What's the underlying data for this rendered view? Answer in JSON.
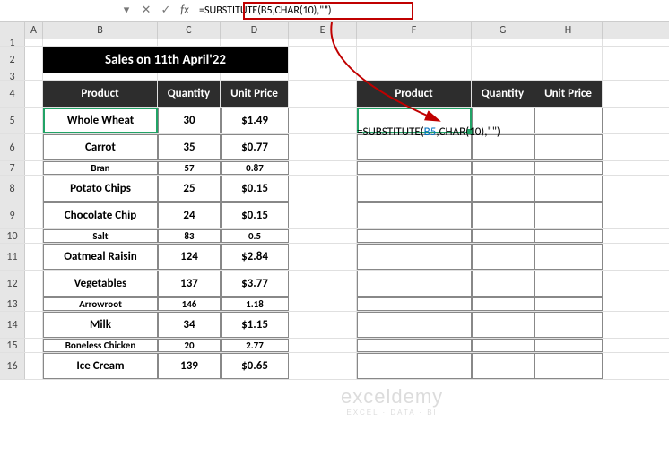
{
  "formula_bar": {
    "formula": "=SUBSTITUTE(B5,CHAR(10),\"\")",
    "fx_label": "fx"
  },
  "columns": [
    "A",
    "B",
    "C",
    "D",
    "E",
    "F",
    "G",
    "H"
  ],
  "row_numbers": [
    "1",
    "2",
    "3",
    "4",
    "5",
    "6",
    "7",
    "8",
    "9",
    "10",
    "11",
    "12",
    "13",
    "14",
    "15",
    "16"
  ],
  "title": "Sales on 11th April'22",
  "headers": {
    "product": "Product",
    "quantity": "Quantity",
    "unit_price": "Unit Price"
  },
  "data_rows": [
    {
      "product": "Whole Wheat",
      "qty": "30",
      "price": "$1.49",
      "thin": false
    },
    {
      "product": "Carrot",
      "qty": "35",
      "price": "$0.77",
      "thin": false
    },
    {
      "product": "Bran",
      "qty": "57",
      "price": "0.87",
      "thin": true
    },
    {
      "product": "Potato Chips",
      "qty": "25",
      "price": "$0.15",
      "thin": false
    },
    {
      "product": "Chocolate Chip",
      "qty": "24",
      "price": "$0.15",
      "thin": false
    },
    {
      "product": "Salt",
      "qty": "83",
      "price": "0.5",
      "thin": true
    },
    {
      "product": "Oatmeal Raisin",
      "qty": "124",
      "price": "$2.84",
      "thin": false
    },
    {
      "product": "Vegetables",
      "qty": "137",
      "price": "$3.77",
      "thin": false
    },
    {
      "product": "Arrowroot",
      "qty": "146",
      "price": "1.18",
      "thin": true
    },
    {
      "product": "Milk",
      "qty": "34",
      "price": "$1.15",
      "thin": false
    },
    {
      "product": "Boneless Chicken",
      "qty": "20",
      "price": "2.77",
      "thin": true
    },
    {
      "product": "Ice Cream",
      "qty": "139",
      "price": "$0.65",
      "thin": false
    }
  ],
  "cell_formula": {
    "prefix": "=SUBSTITUTE(",
    "ref": "B5",
    "mid": ",CHAR(10),\"\")"
  },
  "watermark": {
    "main": "exceldemy",
    "sub": "EXCEL · DATA · BI"
  },
  "icons": {
    "dropdown": "▾",
    "cancel": "✕",
    "confirm": "✓"
  }
}
